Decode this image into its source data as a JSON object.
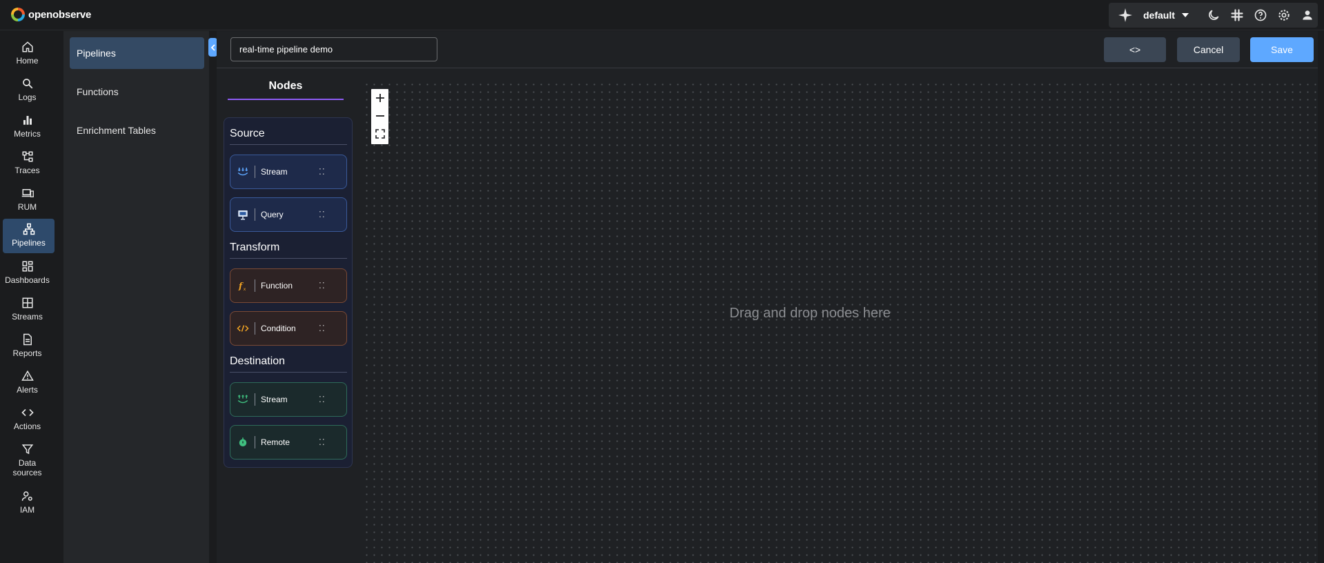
{
  "app": {
    "name": "openobserve"
  },
  "topbar": {
    "org": "default"
  },
  "nav": {
    "items": [
      {
        "label": "Home"
      },
      {
        "label": "Logs"
      },
      {
        "label": "Metrics"
      },
      {
        "label": "Traces"
      },
      {
        "label": "RUM"
      },
      {
        "label": "Pipelines",
        "active": true
      },
      {
        "label": "Dashboards"
      },
      {
        "label": "Streams"
      },
      {
        "label": "Reports"
      },
      {
        "label": "Alerts"
      },
      {
        "label": "Actions"
      },
      {
        "label": "Data sources"
      },
      {
        "label": "IAM"
      }
    ]
  },
  "subnav": {
    "items": [
      {
        "label": "Pipelines",
        "active": true
      },
      {
        "label": "Functions"
      },
      {
        "label": "Enrichment Tables"
      }
    ]
  },
  "editor": {
    "pipeline_name": "real-time pipeline demo",
    "code_label": "<>",
    "cancel_label": "Cancel",
    "save_label": "Save",
    "nodes_tab": "Nodes",
    "drop_hint": "Drag and drop nodes here"
  },
  "nodes": {
    "source": {
      "title": "Source",
      "items": [
        {
          "label": "Stream",
          "icon": "stream-icon"
        },
        {
          "label": "Query",
          "icon": "query-icon"
        }
      ]
    },
    "transform": {
      "title": "Transform",
      "items": [
        {
          "label": "Function",
          "icon": "function-icon"
        },
        {
          "label": "Condition",
          "icon": "condition-icon"
        }
      ]
    },
    "destination": {
      "title": "Destination",
      "items": [
        {
          "label": "Stream",
          "icon": "stream-out-icon"
        },
        {
          "label": "Remote",
          "icon": "remote-icon"
        }
      ]
    }
  },
  "colors": {
    "accent": "#5ea8ff",
    "active_nav": "#2e4a6b",
    "tab_underline": "#8e5cf6",
    "source_border": "#3a5a9a",
    "transform_border": "#7a4a35",
    "destination_border": "#2e6b5a"
  }
}
